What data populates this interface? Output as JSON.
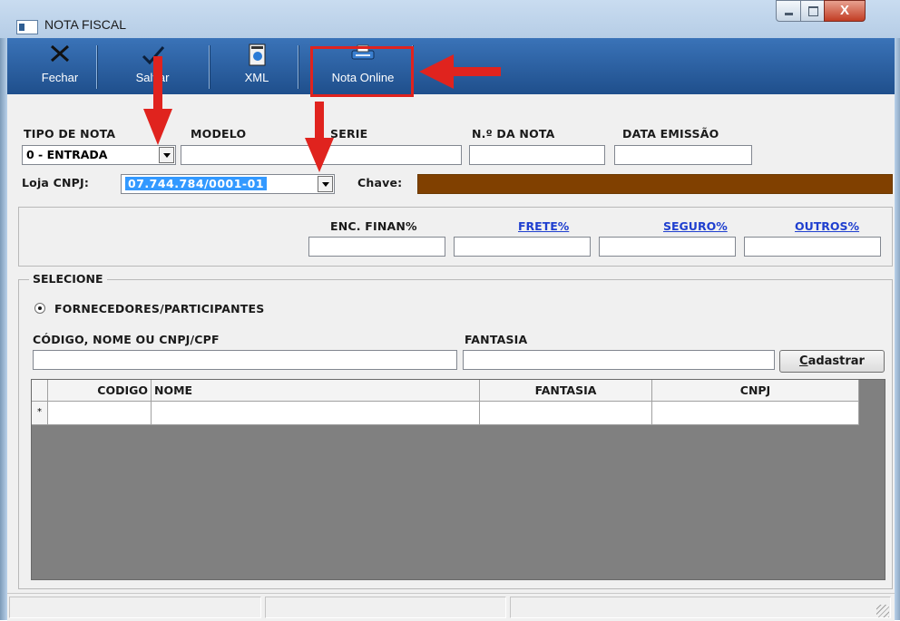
{
  "window": {
    "title": "NOTA FISCAL",
    "close_glyph": "X"
  },
  "toolbar": {
    "fechar": "Fechar",
    "salvar": "Salvar",
    "xml": "XML",
    "nota_online": "Nota Online"
  },
  "header": {
    "tipo_nota_label": "TIPO DE NOTA",
    "tipo_nota_value": "0 - ENTRADA",
    "modelo_label": "MODELO",
    "serie_label": "SERIE",
    "numero_label": "N.º DA NOTA",
    "data_label": "DATA EMISSÃO",
    "loja_label": "Loja CNPJ:",
    "loja_value": "07.744.784/0001-01",
    "chave_label": "Chave:"
  },
  "valores": {
    "enc_finan": "ENC. FINAN%",
    "frete": "FRETE%",
    "seguro": "SEGURO%",
    "outros": "OUTROS%"
  },
  "selecione": {
    "legend": "SELECIONE",
    "radio_label": "FORNECEDORES/PARTICIPANTES",
    "codigo_label": "CÓDIGO, NOME OU CNPJ/CPF",
    "fantasia_label": "FANTASIA",
    "cadastrar_accel": "C",
    "cadastrar_rest": "adastrar"
  },
  "grid": {
    "columns": [
      "CODIGO",
      "NOME",
      "FANTASIA",
      "CNPJ"
    ],
    "new_row_marker": "*"
  },
  "colors": {
    "toolbar": "#2a5f9e",
    "chave": "#804000",
    "highlight": "#e0231e"
  }
}
